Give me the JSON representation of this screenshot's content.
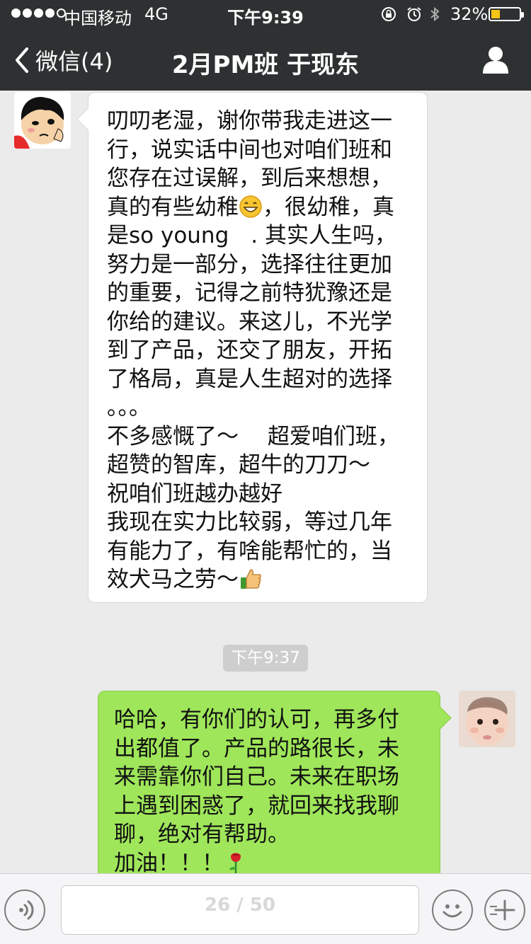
{
  "status_bar": {
    "carrier": "中国移动",
    "network": "4G",
    "time": "下午9:39",
    "battery_percent": "32%",
    "battery_level": 0.32
  },
  "nav": {
    "back_label": "微信(4)",
    "title": "2月PM班 于现东"
  },
  "messages": {
    "incoming": {
      "lines": [
        "叨叨老湿，谢你带我走进这一",
        "行，说实话中间也对咱们班和",
        "您存在过误解，到后来想想，",
        "真的有些幼稚",
        "，很幼稚，真",
        "是so young　. 其实人生吗，",
        "努力是一部分，选择往往更加",
        "的重要，记得之前特犹豫还是",
        "你给的建议。来这儿，不光学",
        "到了产品，还交了朋友，开拓",
        "了格局，真是人生超对的选择",
        "。。。",
        "不多感慨了～　 超爱咱们班，",
        "超赞的智库，超牛的刀刀～",
        "祝咱们班越办越好",
        "我现在实力比较弱，等过几年",
        "有能力了，有啥能帮忙的，当",
        "效犬马之劳～"
      ]
    },
    "timestamp": "下午9:37",
    "outgoing": {
      "lines": [
        "哈哈，有你们的认可，再多付",
        "出都值了。产品的路很长，未",
        "来需靠你们自己。未来在职场",
        "上遇到困惑了，就回来找我聊",
        "聊，绝对有帮助。",
        "加油！！！"
      ]
    }
  },
  "input_bar": {
    "page_indicator": "26 / 50"
  },
  "colors": {
    "nav_bg": "#2e3132",
    "chat_bg": "#ebebeb",
    "outgoing_bubble": "#9fe65a",
    "incoming_bubble": "#ffffff"
  }
}
